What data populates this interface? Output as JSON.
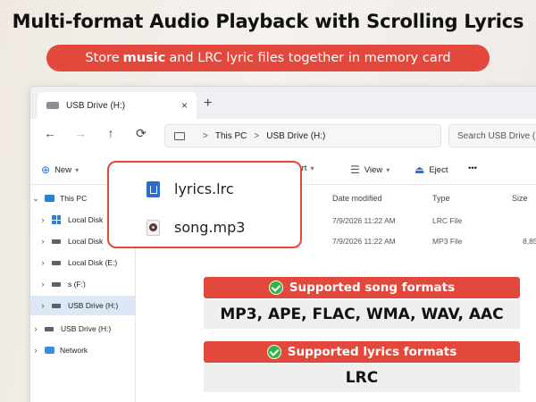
{
  "header": {
    "title": "Multi-format Audio Playback with Scrolling Lyrics",
    "subtitle_pre": "Store",
    "subtitle_bold": "music",
    "subtitle_post": "and LRC lyric files together in memory card"
  },
  "explorer": {
    "tab_label": "USB Drive (H:)",
    "tab_close": "×",
    "tab_add": "+",
    "nav": {
      "back": "←",
      "forward": "→",
      "up": "↑",
      "refresh": "⟳"
    },
    "breadcrumb": [
      "This PC",
      "USB Drive (H:)"
    ],
    "breadcrumb_sep": ">",
    "search_placeholder": "Search USB Drive (H:)",
    "toolbar": {
      "new_label": "New",
      "sort_label": "Sort",
      "view_label": "View",
      "eject_label": "Eject",
      "more_label": "•••"
    },
    "sidebar": [
      {
        "label": "This PC"
      },
      {
        "label": "Local Disk"
      },
      {
        "label": "Local Disk"
      },
      {
        "label": "Local Disk (E:)"
      },
      {
        "label": "s (F:)"
      },
      {
        "label": "USB Drive (H:)"
      },
      {
        "label": "USB Drive (H:)"
      },
      {
        "label": "Network"
      }
    ],
    "columns": {
      "modified": "Date modified",
      "type": "Type",
      "size": "Size"
    },
    "files": [
      {
        "name": "lyrics.lrc",
        "modified": "7/9/2026 11:22 AM",
        "type": "LRC File",
        "size": ""
      },
      {
        "name": "song.mp3",
        "modified": "7/9/2026 11:22 AM",
        "type": "MP3 File",
        "size": "8,85"
      }
    ]
  },
  "formats": {
    "song_heading": "Supported song formats",
    "song_list": "MP3, APE, FLAC, WMA, WAV, AAC",
    "lyrics_heading": "Supported lyrics formats",
    "lyrics_list": "LRC"
  },
  "colors": {
    "accent_red": "#e2483b",
    "check_green": "#36b24a",
    "selection_blue": "#dde8f6"
  }
}
